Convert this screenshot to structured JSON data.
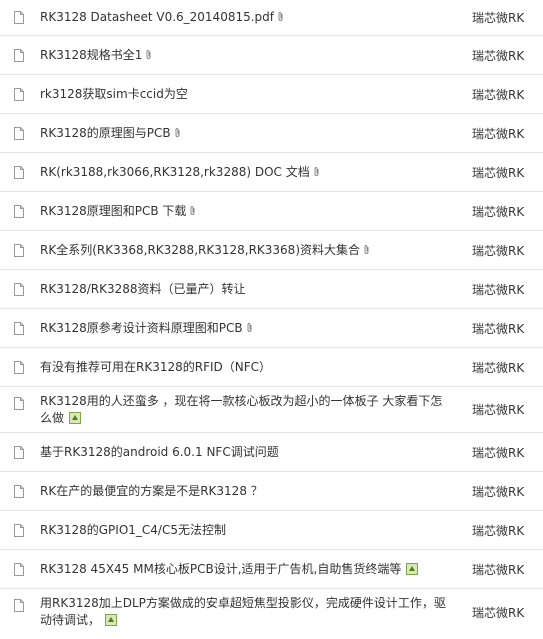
{
  "threads": [
    {
      "title": "RK3128 Datasheet V0.6_20140815.pdf",
      "attach": true,
      "image": false,
      "forum": "瑞芯微RK"
    },
    {
      "title": "RK3128规格书全1",
      "attach": true,
      "image": false,
      "forum": "瑞芯微RK"
    },
    {
      "title": "rk3128获取sim卡ccid为空",
      "attach": false,
      "image": false,
      "forum": "瑞芯微RK"
    },
    {
      "title": "RK3128的原理图与PCB",
      "attach": true,
      "image": false,
      "forum": "瑞芯微RK"
    },
    {
      "title": "RK(rk3188,rk3066,RK3128,rk3288) DOC 文档",
      "attach": true,
      "image": false,
      "forum": "瑞芯微RK"
    },
    {
      "title": "RK3128原理图和PCB 下载",
      "attach": true,
      "image": false,
      "forum": "瑞芯微RK"
    },
    {
      "title": "RK全系列(RK3368,RK3288,RK3128,RK3368)资料大集合",
      "attach": true,
      "image": false,
      "forum": "瑞芯微RK"
    },
    {
      "title": "RK3128/RK3288资料（已量产）转让",
      "attach": false,
      "image": false,
      "forum": "瑞芯微RK"
    },
    {
      "title": "RK3128原参考设计资料原理图和PCB",
      "attach": true,
      "image": false,
      "forum": "瑞芯微RK"
    },
    {
      "title": "有没有推荐可用在RK3128的RFID（NFC）",
      "attach": false,
      "image": false,
      "forum": "瑞芯微RK"
    },
    {
      "title": "RK3128用的人还蛮多 ，现在将一款核心板改为超小的一体板子 大家看下怎么做",
      "attach": false,
      "image": true,
      "forum": "瑞芯微RK"
    },
    {
      "title": "基于RK3128的android 6.0.1 NFC调试问题",
      "attach": false,
      "image": false,
      "forum": "瑞芯微RK"
    },
    {
      "title": "RK在产的最便宜的方案是不是RK3128 ？",
      "attach": false,
      "image": false,
      "forum": "瑞芯微RK"
    },
    {
      "title": "RK3128的GPIO1_C4/C5无法控制",
      "attach": false,
      "image": false,
      "forum": "瑞芯微RK"
    },
    {
      "title": "RK3128 45X45 MM核心板PCB设计,适用于广告机,自助售货终端等",
      "attach": false,
      "image": true,
      "forum": "瑞芯微RK"
    },
    {
      "title": "用RK3128加上DLP方案做成的安卓超短焦型投影仪，完成硬件设计工作，驱动待调试，",
      "attach": false,
      "image": true,
      "forum": "瑞芯微RK"
    }
  ],
  "icons": {
    "row_icon": "document-icon",
    "attachment_icon": "paperclip-icon",
    "image_icon": "image-icon"
  },
  "colors": {
    "text": "#333333",
    "divider": "#e6e6e6",
    "icon_gray": "#999999"
  }
}
